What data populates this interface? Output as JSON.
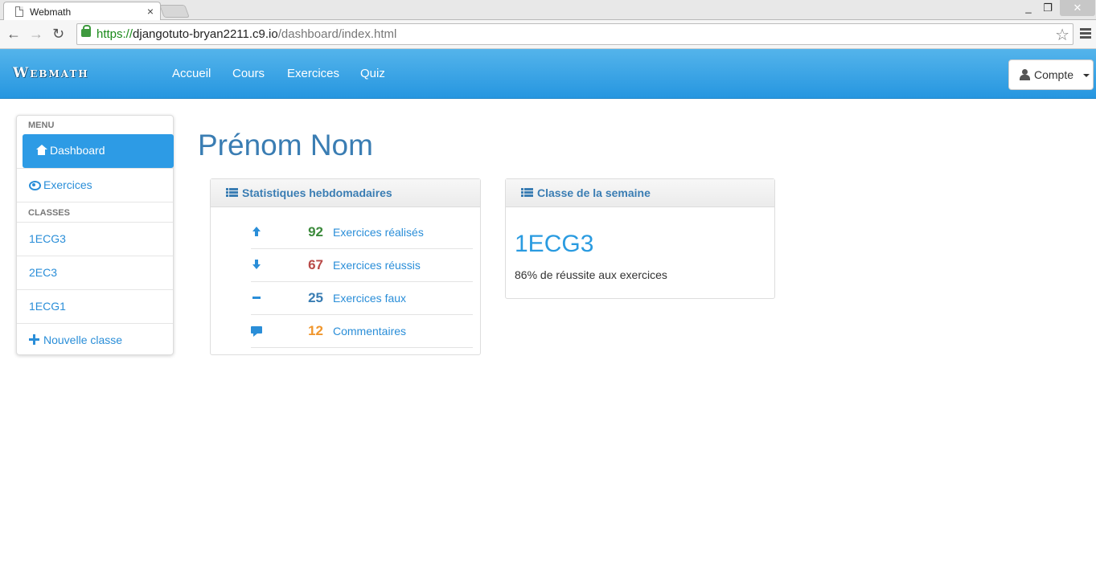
{
  "browser": {
    "tab_title": "Webmath",
    "tab_close": "×",
    "url_scheme": "https://",
    "url_host": "djangotuto-bryan2211.c9.io",
    "url_path": "/dashboard/index.html",
    "win_min": "_",
    "win_max": "❐",
    "win_close": "✕",
    "back": "←",
    "forward": "→",
    "reload": "↻",
    "star": "☆"
  },
  "navbar": {
    "brand": "Webmath",
    "links": [
      "Accueil",
      "Cours",
      "Exercices",
      "Quiz"
    ],
    "account_label": "Compte"
  },
  "sidebar": {
    "menu_header": "MENU",
    "classes_header": "CLASSES",
    "items": [
      {
        "label": "Dashboard",
        "icon": "home-icon",
        "active": true
      },
      {
        "label": "Exercices",
        "icon": "eye-icon"
      }
    ],
    "classes": [
      "1ECG3",
      "2EC3",
      "1ECG1"
    ],
    "new_class": "Nouvelle classe"
  },
  "main": {
    "title": "Prénom Nom",
    "stats": {
      "heading": "Statistiques hebdomadaires",
      "rows": [
        {
          "icon": "arrow-up-icon",
          "value": "92",
          "label": "Exercices réalisés",
          "color": "#3c8a3c"
        },
        {
          "icon": "arrow-down-icon",
          "value": "67",
          "label": "Exercices réussis",
          "color": "#b94a48"
        },
        {
          "icon": "minus-icon",
          "value": "25",
          "label": "Exercices faux",
          "color": "#3a7db3"
        },
        {
          "icon": "comment-icon",
          "value": "12",
          "label": "Commentaires",
          "color": "#f0962c"
        }
      ]
    },
    "class_week": {
      "heading": "Classe de la semaine",
      "name": "1ECG3",
      "description": "86% de réussite aux exercices"
    }
  },
  "colors": {
    "navbar": "#2d9be5",
    "link": "#2a8ed8",
    "title": "#3a7db3"
  }
}
